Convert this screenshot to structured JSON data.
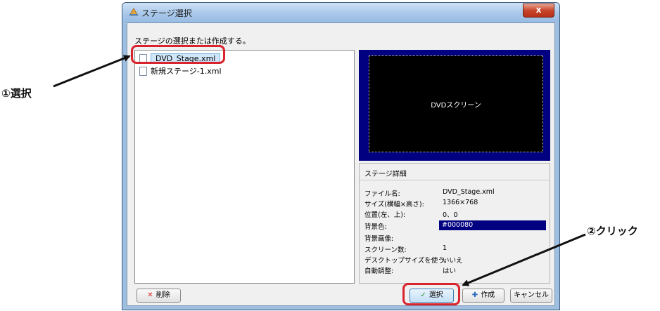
{
  "window": {
    "title": "ステージ選択",
    "close_symbol": "x"
  },
  "instruction": "ステージの選択または作成する。",
  "files": [
    {
      "name": "DVD_Stage.xml",
      "selected": true
    },
    {
      "name": "新規ステージ-1.xml",
      "selected": false
    }
  ],
  "preview": {
    "screen_label": "DVDスクリーン",
    "background_color": "#000080"
  },
  "details": {
    "title": "ステージ詳細",
    "rows": [
      {
        "label": "ファイル名:",
        "value": "DVD_Stage.xml"
      },
      {
        "label": "サイズ(横幅×高さ):",
        "value": "1366×768"
      },
      {
        "label": "位置(左、上):",
        "value": "0、0"
      },
      {
        "label": "背景色:",
        "value": "#000080"
      },
      {
        "label": "背景画像:",
        "value": ""
      },
      {
        "label": "スクリーン数:",
        "value": "1"
      },
      {
        "label": "デスクトップサイズを使う:",
        "value": "いいえ"
      },
      {
        "label": "自動調整:",
        "value": "はい"
      }
    ]
  },
  "buttons": {
    "delete": "削除",
    "select": "選択",
    "create": "作成",
    "cancel": "キャンセル"
  },
  "icons": {
    "delete": "close-icon",
    "select": "check-icon",
    "create": "new-icon"
  },
  "annotations": {
    "step1": "①選択",
    "step2": "②クリック"
  },
  "colors": {
    "highlight": "#d9232d",
    "stage_background": "#000080"
  }
}
